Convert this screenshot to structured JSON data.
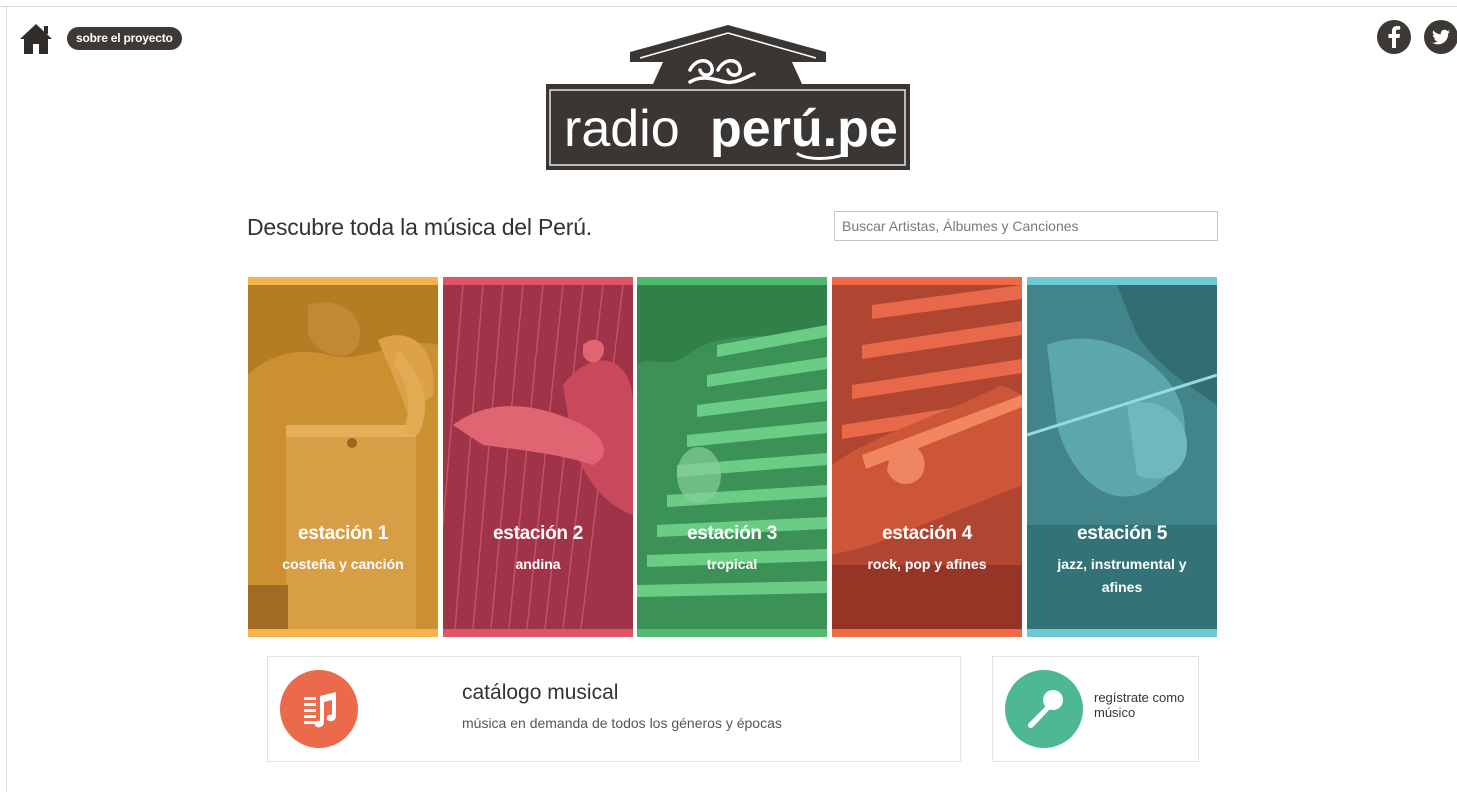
{
  "header": {
    "home_icon": "home-icon",
    "about_label": "sobre el proyecto",
    "social": [
      "facebook-icon",
      "twitter-icon"
    ]
  },
  "logo": {
    "text_light": "radio",
    "text_bold": "perú.pe"
  },
  "hero": {
    "tagline": "Descubre toda la música del Perú."
  },
  "search": {
    "placeholder": "Buscar Artistas, Álbumes y Canciones",
    "value": ""
  },
  "stations": [
    {
      "name": "estación 1",
      "genre": "costeña y canción",
      "color": "#f4b34b",
      "tint": "#c88a2c"
    },
    {
      "name": "estación 2",
      "genre": "andina",
      "color": "#dd5566",
      "tint": "#a83a4d"
    },
    {
      "name": "estación 3",
      "genre": "tropical",
      "color": "#52b86f",
      "tint": "#3b9a5b"
    },
    {
      "name": "estación 4",
      "genre": "rock, pop y afines",
      "color": "#ee6a47",
      "tint": "#c9533a"
    },
    {
      "name": "estación 5",
      "genre": "jazz, instrumental y afines",
      "color": "#6ec9d6",
      "tint": "#3e8a8c"
    }
  ],
  "catalog": {
    "title": "catálogo musical",
    "subtitle": "música en demanda de todos los géneros y épocas",
    "icon": "music-catalog-icon",
    "color": "#ea6a4b"
  },
  "register": {
    "label": "regístrate como músico",
    "icon": "microphone-icon",
    "color": "#4db891"
  }
}
